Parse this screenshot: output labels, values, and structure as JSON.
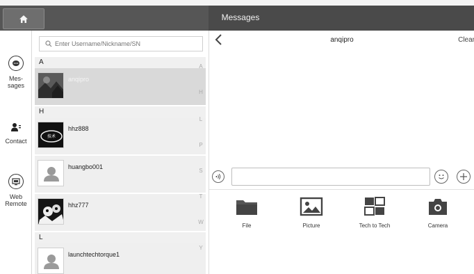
{
  "header": {
    "title": "Messages"
  },
  "nav": {
    "items": [
      {
        "label_line1": "Mes-",
        "label_line2": "sages",
        "icon": "chat-bubble-icon"
      },
      {
        "label_line1": "Contact",
        "icon": "contact-icon"
      },
      {
        "label_line1": "Web",
        "label_line2": "Remote",
        "icon": "remote-screen-icon"
      }
    ]
  },
  "search": {
    "placeholder": "Enter Username/Nickname/SN"
  },
  "contacts": {
    "sections": [
      {
        "letter": "A",
        "rows": [
          {
            "name": "anqipro",
            "selected": true
          }
        ]
      },
      {
        "letter": "H",
        "rows": [
          {
            "name": "hhz888"
          },
          {
            "name": "huangbo001"
          },
          {
            "name": "hhz777"
          }
        ]
      },
      {
        "letter": "L",
        "rows": [
          {
            "name": "launchtechtorque1"
          }
        ]
      }
    ],
    "avatar_badge": "技术"
  },
  "alphabet_index": [
    "A",
    "H",
    "L",
    "P",
    "S",
    "T",
    "W",
    "Y"
  ],
  "chat": {
    "title": "anqipro",
    "clear_label": "Clear"
  },
  "tools": [
    {
      "label": "File",
      "icon": "folder-icon"
    },
    {
      "label": "Picture",
      "icon": "picture-icon"
    },
    {
      "label": "Tech to Tech",
      "icon": "tech-to-tech-icon"
    },
    {
      "label": "Camera",
      "icon": "camera-icon"
    }
  ],
  "colors": {
    "topbar": "#565656",
    "selected_row": "#d9d9d9",
    "row": "#efefef"
  }
}
